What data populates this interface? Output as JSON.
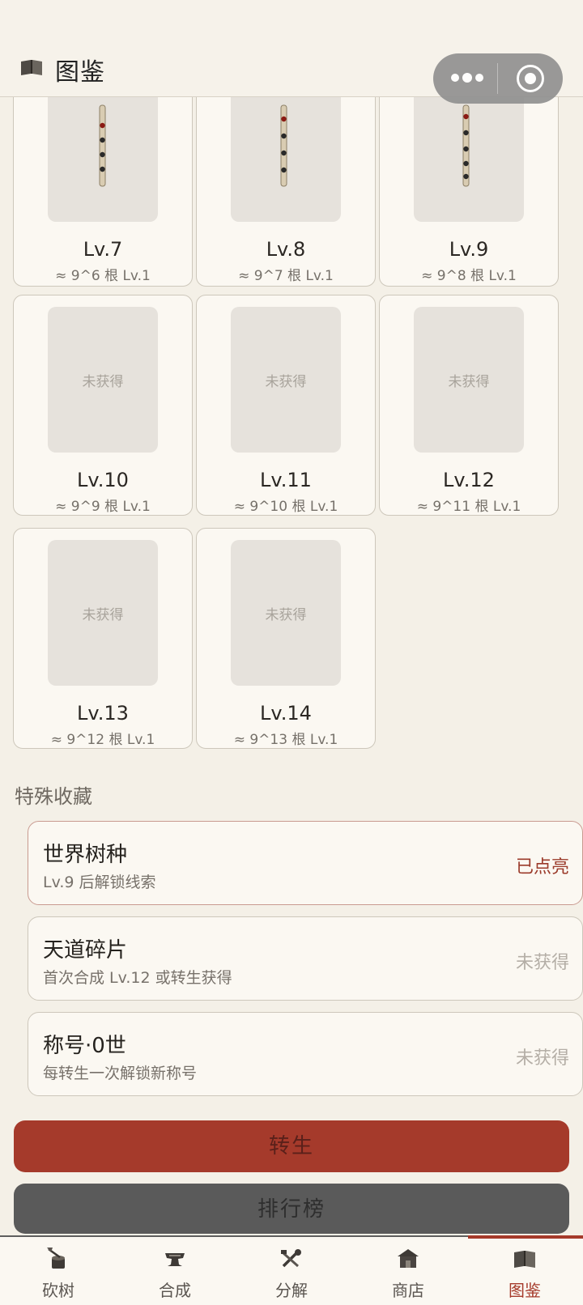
{
  "header": {
    "title": "图鉴"
  },
  "cards": [
    {
      "level": "Lv.7",
      "requirement": "≈ 9^6 根 Lv.1",
      "obtained": true
    },
    {
      "level": "Lv.8",
      "requirement": "≈ 9^7 根 Lv.1",
      "obtained": true
    },
    {
      "level": "Lv.9",
      "requirement": "≈ 9^8 根 Lv.1",
      "obtained": true
    },
    {
      "level": "Lv.10",
      "requirement": "≈ 9^9 根 Lv.1",
      "obtained": false,
      "locked_label": "未获得"
    },
    {
      "level": "Lv.11",
      "requirement": "≈ 9^10 根 Lv.1",
      "obtained": false,
      "locked_label": "未获得"
    },
    {
      "level": "Lv.12",
      "requirement": "≈ 9^11 根 Lv.1",
      "obtained": false,
      "locked_label": "未获得"
    },
    {
      "level": "Lv.13",
      "requirement": "≈ 9^12 根 Lv.1",
      "obtained": false,
      "locked_label": "未获得"
    },
    {
      "level": "Lv.14",
      "requirement": "≈ 9^13 根 Lv.1",
      "obtained": false,
      "locked_label": "未获得"
    }
  ],
  "special": {
    "title": "特殊收藏",
    "items": [
      {
        "name": "世界树种",
        "desc": "Lv.9 后解锁线索",
        "status": "已点亮"
      },
      {
        "name": "天道碎片",
        "desc": "首次合成 Lv.12 或转生获得",
        "status": "未获得"
      },
      {
        "name": "称号·0世",
        "desc": "每转生一次解锁新称号",
        "status": "未获得"
      }
    ]
  },
  "buttons": {
    "rebirth": "转生",
    "leaderboard": "排行榜"
  },
  "tabs": [
    {
      "label": "砍树"
    },
    {
      "label": "合成"
    },
    {
      "label": "分解"
    },
    {
      "label": "商店"
    },
    {
      "label": "图鉴"
    }
  ],
  "colors": {
    "accent": "#a53a2b",
    "background": "#f4f0e7"
  }
}
